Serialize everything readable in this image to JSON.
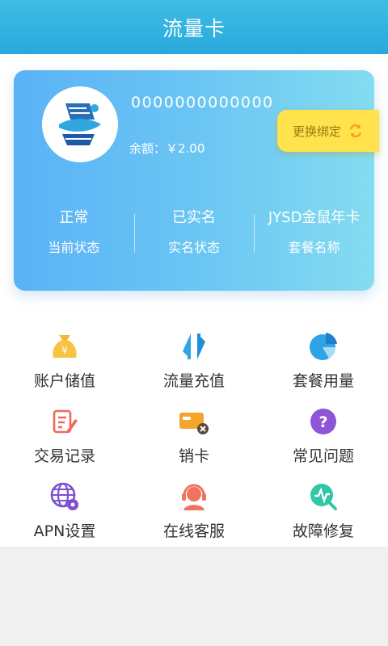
{
  "header": {
    "title": "流量卡"
  },
  "card": {
    "number": "0000000000000",
    "balance": "余额：￥2.00",
    "rebind_label": "更换绑定",
    "stats": [
      {
        "value": "正常",
        "label": "当前状态"
      },
      {
        "value": "已实名",
        "label": "实名状态"
      },
      {
        "value": "JYSD金鼠年卡",
        "label": "套餐名称"
      }
    ]
  },
  "menu": [
    {
      "label": "账户储值",
      "icon": "money-bag-icon"
    },
    {
      "label": "流量充值",
      "icon": "transfer-arrows-icon"
    },
    {
      "label": "套餐用量",
      "icon": "pie-chart-icon"
    },
    {
      "label": "交易记录",
      "icon": "record-edit-icon"
    },
    {
      "label": "销卡",
      "icon": "cancel-card-icon"
    },
    {
      "label": "常见问题",
      "icon": "question-icon"
    },
    {
      "label": "APN设置",
      "icon": "globe-settings-icon"
    },
    {
      "label": "在线客服",
      "icon": "customer-service-icon"
    },
    {
      "label": "故障修复",
      "icon": "repair-search-icon"
    }
  ],
  "colors": {
    "header": "#2aa8dd",
    "card_start": "#5ab2f6",
    "card_end": "#84dcf0",
    "rebind_bg": "#ffe24c"
  }
}
